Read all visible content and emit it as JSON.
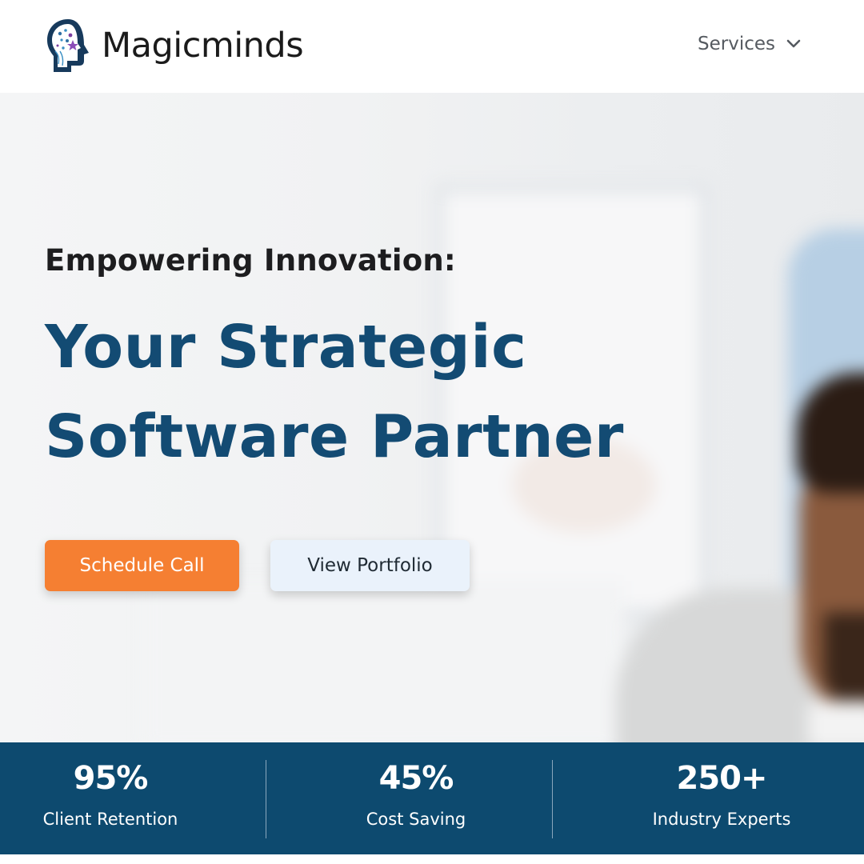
{
  "header": {
    "logo_text": "Magicminds",
    "nav": {
      "services_label": "Services"
    }
  },
  "hero": {
    "eyebrow": "Empowering Innovation:",
    "headline_line1": "Your Strategic",
    "headline_line2": "Software Partner",
    "primary_button": "Schedule Call",
    "secondary_button": "View Portfolio"
  },
  "stats": [
    {
      "value": "95%",
      "label": "Client Retention"
    },
    {
      "value": "45%",
      "label": "Cost Saving"
    },
    {
      "value": "250+",
      "label": "Industry Experts"
    }
  ],
  "colors": {
    "brand_blue": "#134b73",
    "stats_bar": "#0d4a6f",
    "accent_orange": "#f57f32",
    "secondary_button_bg": "#eaf2fb"
  },
  "icons": [
    "brain-head-logo-icon",
    "chevron-down-icon"
  ]
}
